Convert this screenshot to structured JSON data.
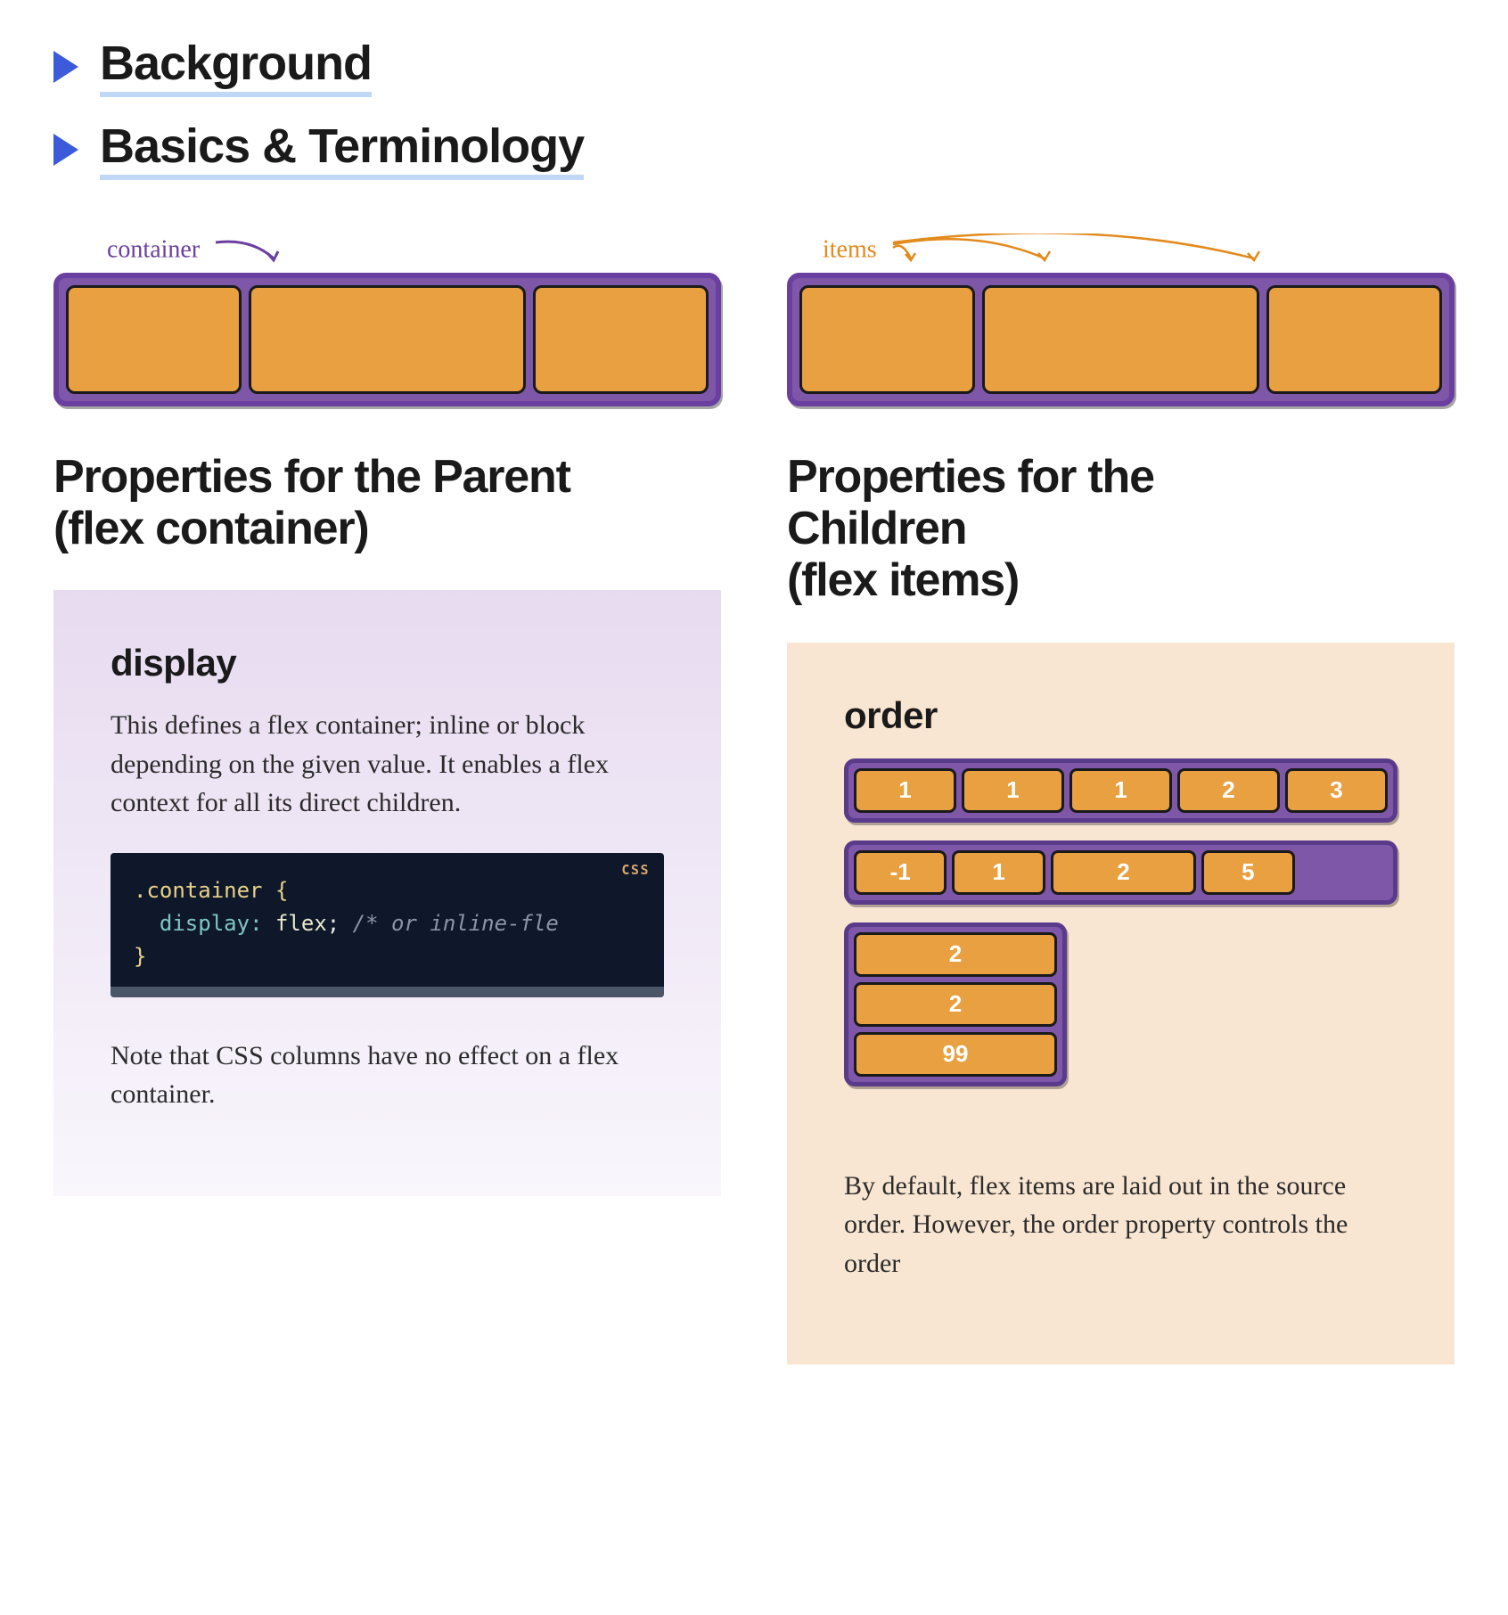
{
  "accordion": {
    "item1": "Background",
    "item2": "Basics & Terminology"
  },
  "left": {
    "diagram_label": "container",
    "section_title_line1": "Properties for the Parent",
    "section_title_line2": "(flex container)",
    "property": {
      "name": "display",
      "desc": "This defines a flex container; inline or block depending on the given value. It enables a flex context for all its direct children.",
      "code_lang": "CSS",
      "code": {
        "selector": ".container",
        "open_brace": "{",
        "prop": "display",
        "colon": ":",
        "value": "flex",
        "semi": ";",
        "comment": "/* or inline-fle",
        "close_brace": "}"
      },
      "note": "Note that CSS columns have no effect on a flex container."
    }
  },
  "right": {
    "diagram_label": "items",
    "section_title_line1": "Properties for the",
    "section_title_line2": "Children",
    "section_title_line3": "(flex items)",
    "property": {
      "name": "order",
      "row1": [
        "1",
        "1",
        "1",
        "2",
        "3"
      ],
      "row2": [
        "-1",
        "1",
        "2",
        "5"
      ],
      "col": [
        "2",
        "2",
        "99"
      ],
      "desc": "By default, flex items are laid out in the source order. However, the order property controls the order"
    }
  }
}
